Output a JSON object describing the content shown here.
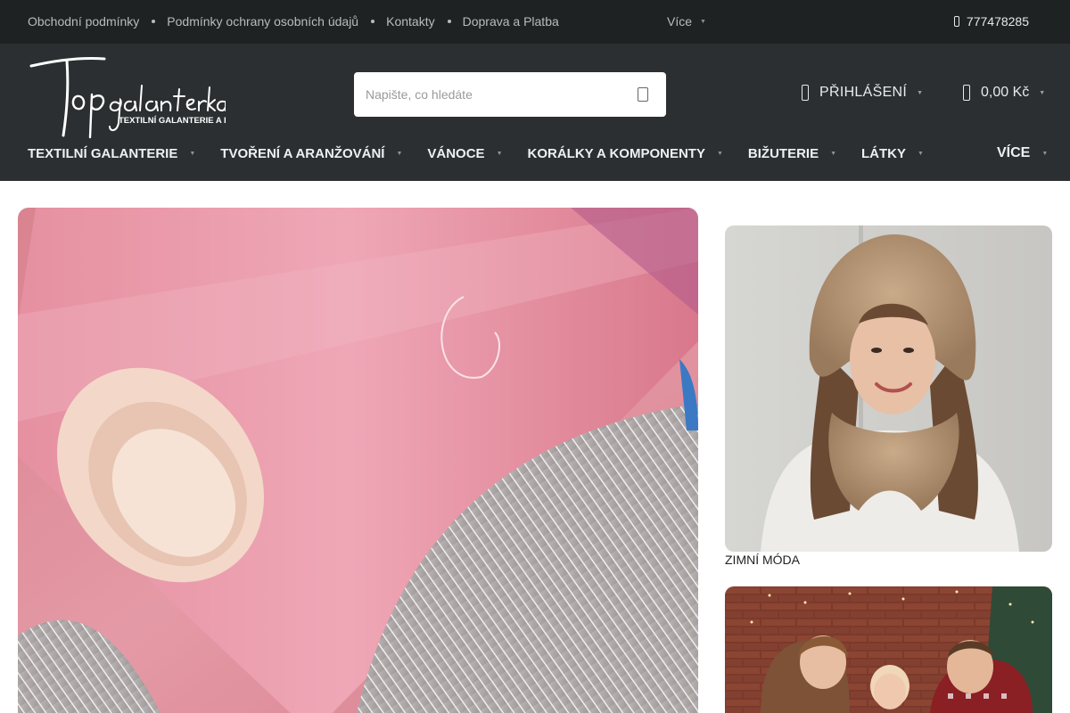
{
  "topbar": {
    "links": [
      "Obchodní podmínky",
      "Podmínky ochrany osobních údajů",
      "Kontakty",
      "Doprava a Platba"
    ],
    "more_label": "Více",
    "phone": "777478285"
  },
  "header": {
    "logo": {
      "main_text": "Topgalanterka",
      "tagline": "TEXTILNÍ GALANTERIE A LÁTKY"
    },
    "search": {
      "placeholder": "Napište, co hledáte",
      "value": ""
    },
    "login_label": "PŘIHLÁŠENÍ",
    "cart_total": "0,00 Kč"
  },
  "nav": {
    "items": [
      "TEXTILNÍ GALANTERIE",
      "TVOŘENÍ A ARANŽOVÁNÍ",
      "VÁNOCE",
      "KORÁLKY A KOMPONENTY",
      "BIŽUTERIE",
      "LÁTKY"
    ],
    "more_label": "VÍCE"
  },
  "banners": {
    "side1_label": "ZIMNÍ MÓDA"
  },
  "icons": {
    "phone": "phone-icon",
    "search": "search-icon",
    "user": "user-icon",
    "cart": "cart-icon",
    "chevron": "chevron-down-icon"
  },
  "colors": {
    "topbar_bg": "#1f2223",
    "header_bg": "#2b2f31",
    "text_light": "#eef0f2"
  }
}
